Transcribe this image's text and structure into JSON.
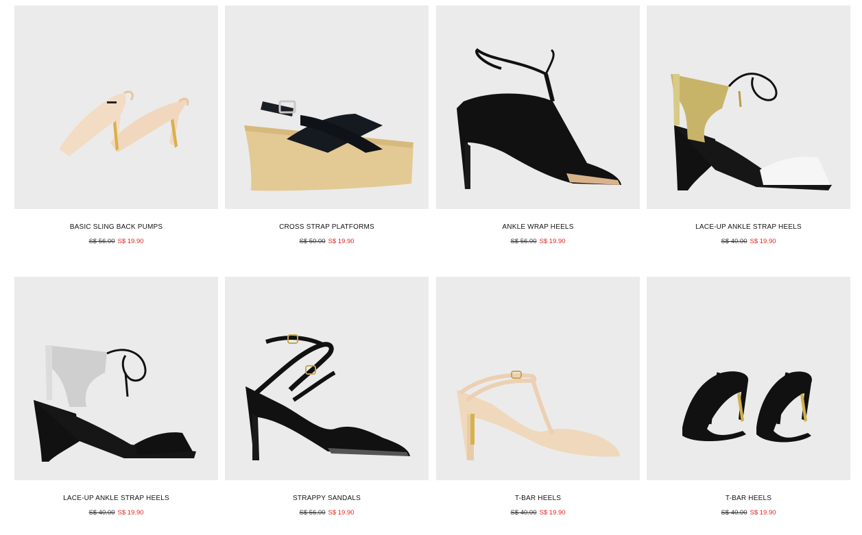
{
  "products": [
    {
      "name": "BASIC SLING BACK PUMPS",
      "old_price": "S$ 56.00",
      "new_price": "S$ 19.90",
      "icon": "nude-slingback-pumps-image"
    },
    {
      "name": "CROSS STRAP PLATFORMS",
      "old_price": "S$ 50.00",
      "new_price": "S$ 19.90",
      "icon": "wooden-platform-sandal-image"
    },
    {
      "name": "ANKLE WRAP HEELS",
      "old_price": "S$ 56.00",
      "new_price": "S$ 19.90",
      "icon": "black-ankle-wrap-heel-image"
    },
    {
      "name": "LACE-UP ANKLE STRAP HEELS",
      "old_price": "S$ 40.00",
      "new_price": "S$ 19.90",
      "icon": "gold-lace-up-wedge-image"
    },
    {
      "name": "LACE-UP ANKLE STRAP HEELS",
      "old_price": "S$ 40.00",
      "new_price": "S$ 19.90",
      "icon": "silver-lace-up-wedge-image"
    },
    {
      "name": "STRAPPY SANDALS",
      "old_price": "S$ 56.00",
      "new_price": "S$ 19.90",
      "icon": "black-strappy-sandal-image"
    },
    {
      "name": "T-BAR HEELS",
      "old_price": "S$ 40.00",
      "new_price": "S$ 19.90",
      "icon": "nude-t-bar-heel-image"
    },
    {
      "name": "T-BAR HEELS",
      "old_price": "S$ 40.00",
      "new_price": "S$ 19.90",
      "icon": "black-t-bar-heels-pair-image"
    }
  ],
  "colors": {
    "card_bg": "#ebebeb",
    "sale_price": "#e2231a",
    "text": "#111111"
  }
}
